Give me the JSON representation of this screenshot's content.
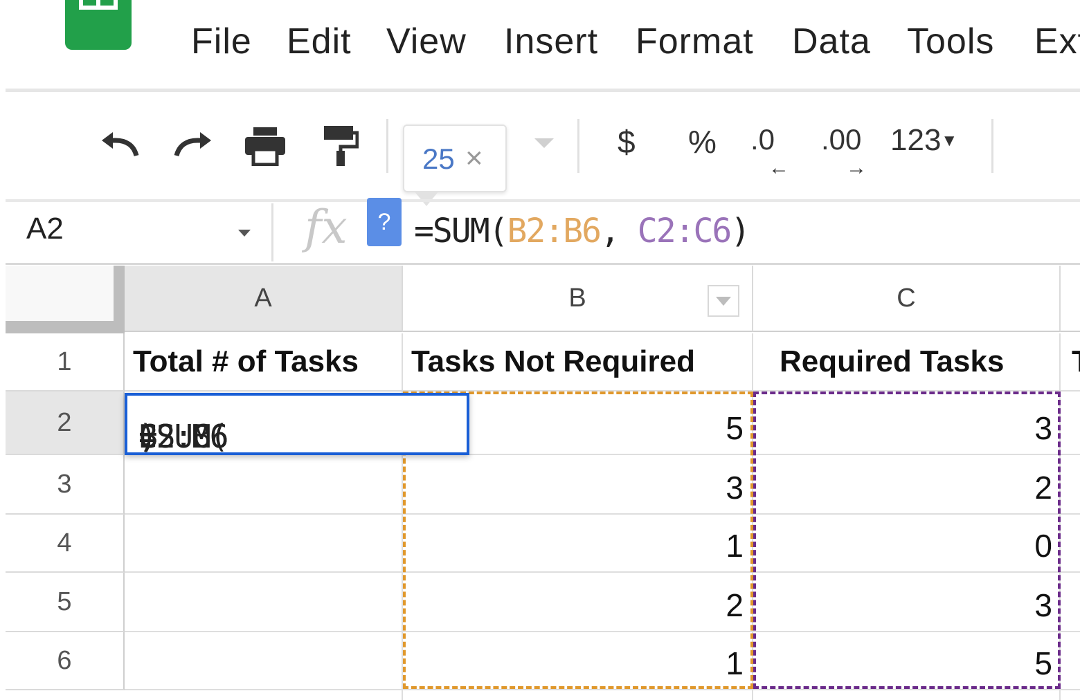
{
  "menu": {
    "items": [
      "File",
      "Edit",
      "View",
      "Insert",
      "Format",
      "Data",
      "Tools",
      "Ext"
    ]
  },
  "toolbar": {
    "icons": [
      "undo-icon",
      "redo-icon",
      "print-icon",
      "paint-format-icon"
    ],
    "tooltip_value": "25",
    "tooltip_close": "×",
    "currency": "$",
    "percent": "%",
    "decrease_decimal": ".0",
    "increase_decimal": ".00",
    "more_formats": "123"
  },
  "formula_bar": {
    "name_box": "A2",
    "fx": "fx",
    "help_badge": "?",
    "formula_prefix": "=SUM(",
    "range1": "B2:B6",
    "separator": ", ",
    "range2": "C2:C6",
    "formula_suffix": ")"
  },
  "grid": {
    "columns": [
      "A",
      "B",
      "C"
    ],
    "rows": [
      "1",
      "2",
      "3",
      "4",
      "5",
      "6"
    ],
    "headers": {
      "a": "Total # of Tasks",
      "b": "Tasks Not Required",
      "c": "Required Tasks",
      "d": "T"
    },
    "col_b_values": [
      "5",
      "3",
      "1",
      "2",
      "1"
    ],
    "col_c_values": [
      "3",
      "2",
      "0",
      "3",
      "5"
    ],
    "active_cell": {
      "prefix": "=SUM(",
      "range1": "B2:B6",
      "separator": ", ",
      "range2": "C2:C6",
      "suffix": ")"
    }
  },
  "colors": {
    "range_b": "#e0982c",
    "range_c": "#6b2b8a",
    "active_border": "#1a5fd6",
    "sheets_green": "#22a04a"
  }
}
